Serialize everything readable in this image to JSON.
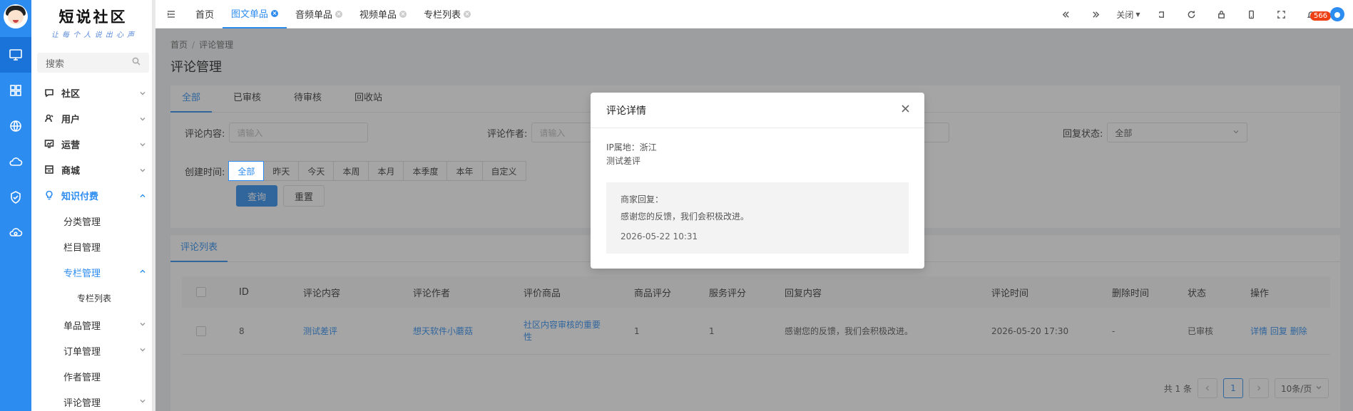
{
  "brand": {
    "logo": "短说社区",
    "slogan": "让 每 个 人 说 出 心 声"
  },
  "search": {
    "placeholder": "搜索"
  },
  "menu": {
    "community": "社区",
    "users": "用户",
    "operations": "运营",
    "mall": "商城",
    "knowledge": "知识付费",
    "category": "分类管理",
    "column": "栏目管理",
    "special": "专栏管理",
    "special_list": "专栏列表",
    "single": "单品管理",
    "orders": "订单管理",
    "authors": "作者管理",
    "comments": "评论管理"
  },
  "topbar": {
    "tabs": [
      "首页",
      "图文单品",
      "音频单品",
      "视频单品",
      "专栏列表"
    ],
    "close_label": "关闭",
    "badge_count": "566"
  },
  "breadcrumb": {
    "home": "首页",
    "sep": "/",
    "current": "评论管理"
  },
  "page_title": "评论管理",
  "status_tabs": [
    "全部",
    "已审核",
    "待审核",
    "回收站"
  ],
  "filters": {
    "content_label": "评论内容:",
    "content_placeholder": "请输入",
    "author_label": "评论作者:",
    "author_placeholder": "请输入",
    "reply_status_label": "回复状态:",
    "reply_status_value": "全部",
    "created_label": "创建时间:",
    "time_options": [
      "全部",
      "昨天",
      "今天",
      "本周",
      "本月",
      "本季度",
      "本年",
      "自定义"
    ],
    "query_btn": "查询",
    "reset_btn": "重置"
  },
  "list_tab": "评论列表",
  "table": {
    "headers": [
      "ID",
      "评论内容",
      "评论作者",
      "评价商品",
      "商品评分",
      "服务评分",
      "回复内容",
      "评论时间",
      "删除时间",
      "状态",
      "操作"
    ],
    "rows": [
      {
        "id": "8",
        "content": "测试差评",
        "author": "想天软件小蘑菇",
        "product": "社区内容审核的重要性",
        "product_line1": "社区内容审核的重要",
        "product_line2": "性",
        "product_score": "1",
        "service_score": "1",
        "reply": "感谢您的反馈，我们会积极改进。",
        "time": "2026-05-20 17:30",
        "deleted": "-",
        "status": "已审核",
        "actions": [
          "详情",
          "回复",
          "删除"
        ]
      }
    ]
  },
  "pagination": {
    "total": "共 1 条",
    "current": "1",
    "page_size": "10条/页"
  },
  "modal": {
    "title": "评论详情",
    "ip": "IP属地：浙江",
    "content": "测试差评",
    "reply_label": "商家回复：",
    "reply_text": "感谢您的反馈，我们会积极改进。",
    "reply_time": "2026-05-22 10:31"
  },
  "colors": {
    "primary": "#2d8cf0",
    "badge": "#ed4014"
  }
}
